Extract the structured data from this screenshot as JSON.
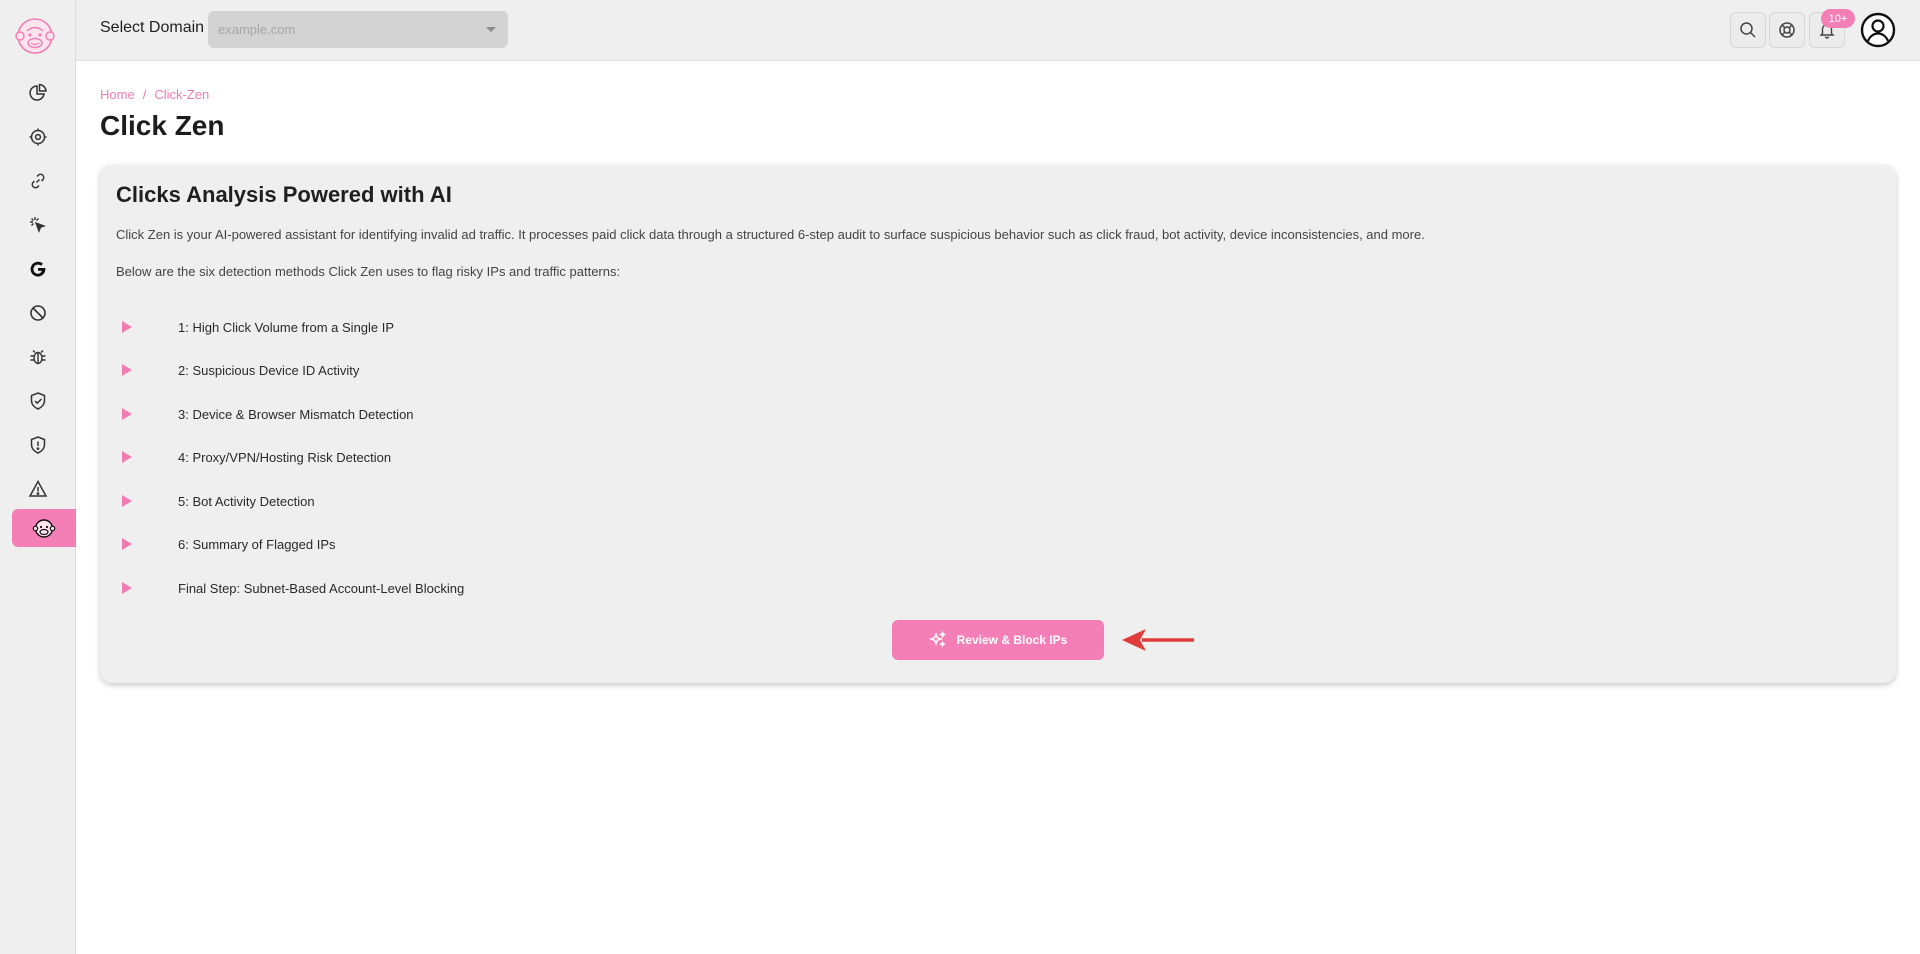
{
  "header": {
    "domain_label": "Select Domain",
    "domain_placeholder": "example.com",
    "notification_badge": "10+"
  },
  "sidebar": {
    "items": [
      {
        "icon": "pie-chart-icon"
      },
      {
        "icon": "settings-icon"
      },
      {
        "icon": "link-icon"
      },
      {
        "icon": "click-pointer-icon"
      },
      {
        "icon": "google-icon"
      },
      {
        "icon": "block-icon"
      },
      {
        "icon": "bug-icon"
      },
      {
        "icon": "shield-check-icon"
      },
      {
        "icon": "shield-alert-icon"
      },
      {
        "icon": "warning-icon"
      },
      {
        "icon": "monkey-icon",
        "active": true
      }
    ]
  },
  "breadcrumb": {
    "home": "Home",
    "separator": "/",
    "current": "Click-Zen"
  },
  "page": {
    "title": "Click Zen"
  },
  "card": {
    "title": "Clicks Analysis Powered with AI",
    "description": "Click Zen is your AI-powered assistant for identifying invalid ad traffic. It processes paid click data through a structured 6-step audit to surface suspicious behavior such as click fraud, bot activity, device inconsistencies, and more.",
    "subtitle": "Below are the six detection methods Click Zen uses to flag risky IPs and traffic patterns:",
    "steps": [
      "1: High Click Volume from a Single IP",
      "2: Suspicious Device ID Activity",
      "3: Device & Browser Mismatch Detection",
      "4: Proxy/VPN/Hosting Risk Detection",
      "5: Bot Activity Detection",
      "6: Summary of Flagged IPs",
      "Final Step: Subnet-Based Account-Level Blocking"
    ],
    "cta_label": "Review & Block IPs"
  },
  "colors": {
    "accent": "#f47fb7",
    "annotation_arrow": "#e03c3c"
  }
}
